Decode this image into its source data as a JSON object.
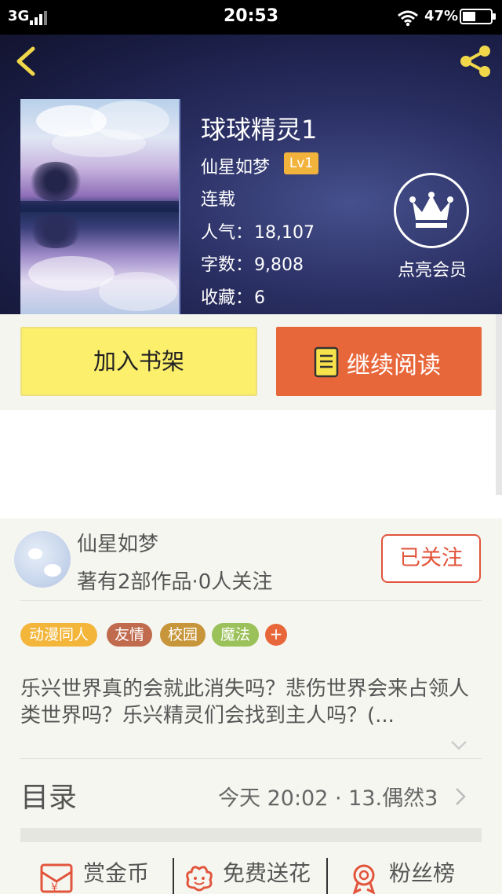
{
  "status_bar": {
    "network": "3G",
    "time": "20:53",
    "battery": "47%",
    "battery_level": 0.47
  },
  "header": {
    "back_icon": "chevron-left-icon",
    "share_icon": "share-icon",
    "book": {
      "title": "球球精灵1",
      "author": "仙星如梦",
      "level": "Lv1",
      "status": "连载",
      "stats": [
        {
          "label": "人气：",
          "value": "18,107"
        },
        {
          "label": "字数：",
          "value": "9,808"
        },
        {
          "label": "收藏：",
          "value": "6"
        }
      ]
    },
    "vip": {
      "icon": "crown-icon",
      "label": "点亮会员"
    }
  },
  "actions": {
    "add_shelf_label": "加入书架",
    "continue_reading_label": "继续阅读"
  },
  "author_card": {
    "name": "仙星如梦",
    "meta": "著有2部作品·0人关注",
    "follow_label": "已关注"
  },
  "tags": [
    {
      "label": "动漫同人",
      "color": "#f3b63b"
    },
    {
      "label": "友情",
      "color": "#c06a4e"
    },
    {
      "label": "校园",
      "color": "#c7963a"
    },
    {
      "label": "魔法",
      "color": "#9bc15a"
    }
  ],
  "tag_add_label": "+",
  "intro": "乐兴世界真的会就此消失吗？悲伤世界会来占领人类世界吗？乐兴精灵们会找到主人吗？(...",
  "catalog": {
    "title": "目录",
    "latest": "今天 20:02 · 13.偶然3"
  },
  "bottom_actions": [
    {
      "label": "赏金币",
      "icon": "coin-envelope-icon"
    },
    {
      "label": "免费送花",
      "icon": "flower-icon"
    },
    {
      "label": "粉丝榜",
      "icon": "medal-icon"
    }
  ],
  "colors": {
    "accent_orange": "#e8673a",
    "shelf_yellow": "#fcef6c",
    "follow_red": "#e2553c",
    "badge_gold": "#f2b33d"
  }
}
